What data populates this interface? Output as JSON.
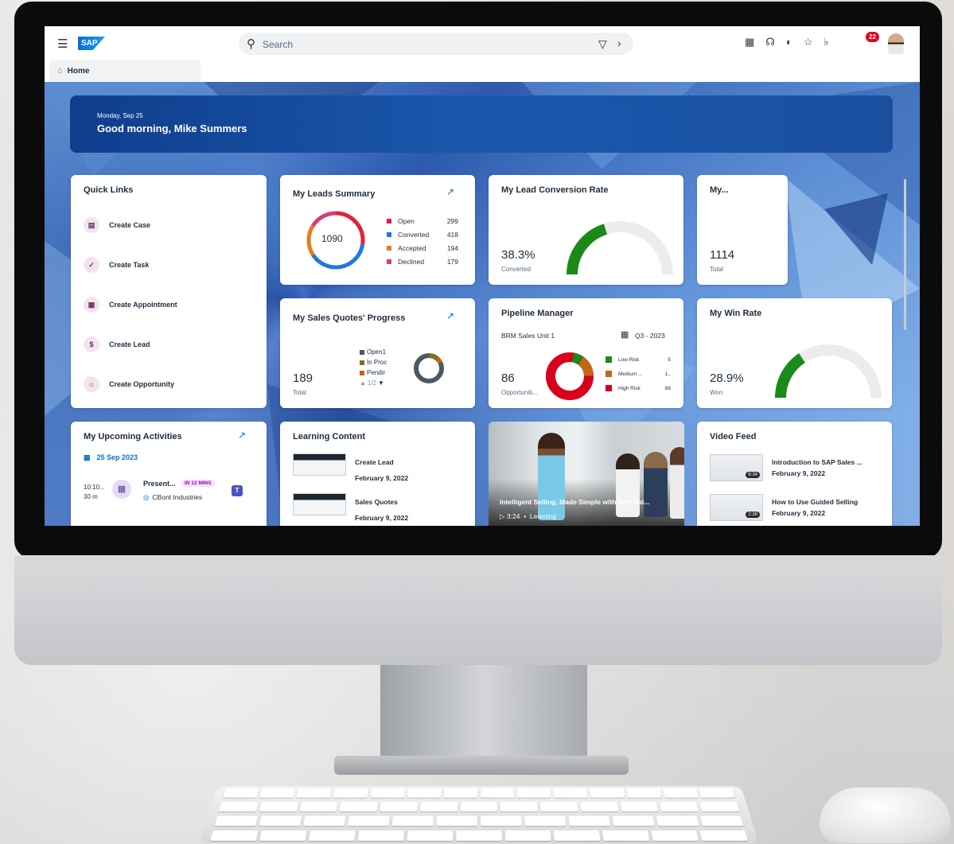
{
  "shell": {
    "search_placeholder": "Search",
    "notification_count": "22"
  },
  "tabs": {
    "home": "Home"
  },
  "greeting": {
    "date": "Monday, Sep 25",
    "message": "Good morning, Mike Summers"
  },
  "quick_links": {
    "title": "Quick Links",
    "items": [
      {
        "label": "Create Case",
        "icon": "ticket-icon"
      },
      {
        "label": "Create Task",
        "icon": "task-icon"
      },
      {
        "label": "Create Appointment",
        "icon": "calendar-icon"
      },
      {
        "label": "Create Lead",
        "icon": "dollar-icon"
      },
      {
        "label": "Create Opportunity",
        "icon": "opportunity-icon"
      }
    ]
  },
  "leads_summary": {
    "title": "My Leads Summary",
    "total": "1090",
    "legend": [
      {
        "label": "Open",
        "value": "299",
        "color": "#e3203b"
      },
      {
        "label": "Converted",
        "value": "418",
        "color": "#1e7ad6"
      },
      {
        "label": "Accepted",
        "value": "194",
        "color": "#e87b1c"
      },
      {
        "label": "Declined",
        "value": "179",
        "color": "#d43e7c"
      }
    ]
  },
  "lead_conversion": {
    "title": "My Lead Conversion Rate",
    "value": "38.3%",
    "label": "Converted",
    "percent": 38.3
  },
  "my_card": {
    "title": "My...",
    "value": "1114",
    "label": "Total"
  },
  "sales_quotes": {
    "title": "My Sales Quotes' Progress",
    "value": "189",
    "label": "Total",
    "legend": [
      {
        "label": "Open1",
        "color": "#4a5866"
      },
      {
        "label": "In Proc",
        "color": "#8a6d1c"
      },
      {
        "label": "Pendir",
        "color": "#c2661a"
      }
    ],
    "pager": "1/2"
  },
  "pipeline": {
    "title": "Pipeline Manager",
    "unit": "BRM Sales Unit 1",
    "period": "Q3 - 2023",
    "value": "86",
    "label": "Opportuniti...",
    "legend": [
      {
        "label": "Low Risk",
        "value": "5",
        "color": "#1a8a1a"
      },
      {
        "label": "Medium ...",
        "value": "1..",
        "color": "#c2661a"
      },
      {
        "label": "High Risk",
        "value": "68",
        "color": "#d9001b"
      }
    ]
  },
  "win_rate": {
    "title": "My Win Rate",
    "value": "28.9%",
    "label": "Won",
    "percent": 28.9
  },
  "activities": {
    "title": "My Upcoming Activities",
    "date": "25 Sep 2023",
    "item": {
      "time": "10:10...",
      "duration": "30 m",
      "title": "Present...",
      "badge": "IN 12 MINS",
      "account": "CBont Industries"
    }
  },
  "learning": {
    "title": "Learning Content",
    "items": [
      {
        "title": "Create Lead",
        "date": "February 9, 2022"
      },
      {
        "title": "Sales Quotes",
        "date": "February 9, 2022"
      }
    ]
  },
  "promo": {
    "title": "Intelligent Selling, Made Simple with SAP Sal...",
    "duration": "3:24",
    "category": "Learning"
  },
  "video_feed": {
    "title": "Video Feed",
    "items": [
      {
        "title": "Introduction to SAP Sales ...",
        "date": "February 9, 2022",
        "duration": "6:34"
      },
      {
        "title": "How to Use Guided Selling",
        "date": "February 9, 2022",
        "duration": "2:38"
      }
    ]
  }
}
